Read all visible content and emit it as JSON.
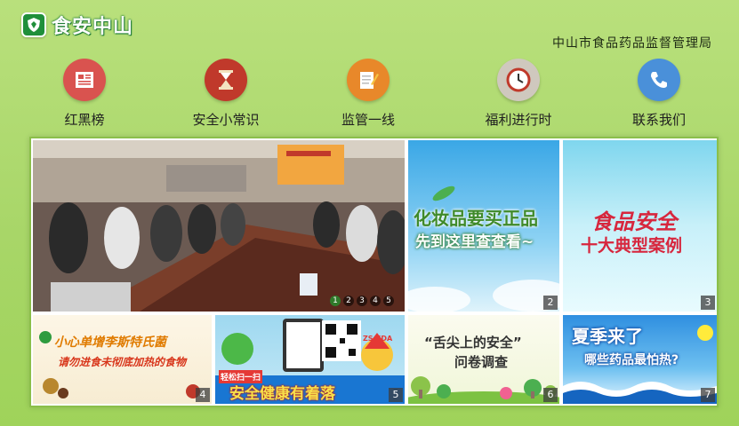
{
  "header": {
    "logo_text": "食安中山",
    "agency": "中山市食品药品监督管理局"
  },
  "nav": [
    {
      "label": "红黑榜",
      "icon": "newspaper-icon",
      "color": "#d9534f"
    },
    {
      "label": "安全小常识",
      "icon": "hourglass-icon",
      "color": "#c0392b"
    },
    {
      "label": "监管一线",
      "icon": "notepad-pencil-icon",
      "color": "#e8882a"
    },
    {
      "label": "福利进行时",
      "icon": "clock-icon",
      "color": "#c9c2b8"
    },
    {
      "label": "联系我们",
      "icon": "phone-icon",
      "color": "#4a90d9"
    }
  ],
  "carousel": {
    "pages": [
      "1",
      "2",
      "3",
      "4",
      "5"
    ],
    "active": 1
  },
  "tiles": [
    {
      "badge": "2",
      "line1": "化妆品要买正品",
      "line2": "先到这里查查看~"
    },
    {
      "badge": "3",
      "line1": "食品安全",
      "line2": "十大典型案例"
    },
    {
      "badge": "4",
      "line1": "小心单增李斯特氏菌",
      "line2": "请勿进食未彻底加热的食物"
    },
    {
      "badge": "5",
      "line1": "轻松扫一扫",
      "line2": "安全健康有着落",
      "mascot": "ZS-FDA"
    },
    {
      "badge": "6",
      "line1": "“舌尖上的安全”",
      "line2": "问卷调查"
    },
    {
      "badge": "7",
      "line1": "夏季来了",
      "line2": "哪些药品最怕热?"
    }
  ]
}
